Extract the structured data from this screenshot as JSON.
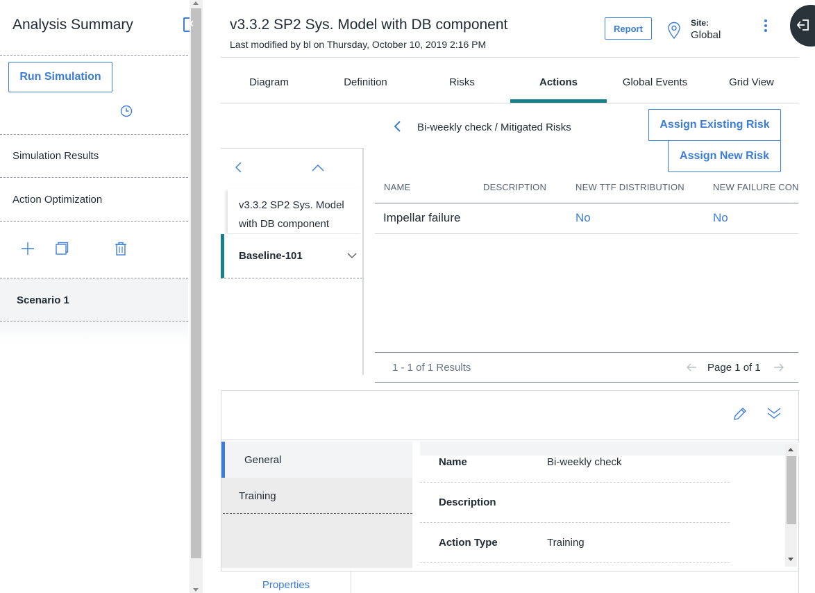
{
  "left_panel": {
    "title": "Analysis Summary",
    "run_simulation": "Run Simulation",
    "items": [
      "Simulation Results",
      "Action Optimization"
    ],
    "scenario": "Scenario 1"
  },
  "header": {
    "title": "v3.3.2 SP2 Sys. Model with DB component",
    "subtitle": "Last modified by bl on Thursday, October 10, 2019 2:16 PM",
    "report_label": "Report",
    "site_label": "Site:",
    "site_value": "Global"
  },
  "tabs": [
    "Diagram",
    "Definition",
    "Risks",
    "Actions",
    "Global Events",
    "Grid View"
  ],
  "active_tab": "Actions",
  "breadcrumb": "Bi-weekly check / Mitigated Risks",
  "assign_existing": "Assign Existing Risk",
  "assign_new": "Assign New Risk",
  "tree": {
    "node1": "v3.3.2 SP2 Sys. Model with DB component",
    "node2": "Baseline-101"
  },
  "grid": {
    "columns": [
      "NAME",
      "DESCRIPTION",
      "NEW TTF DISTRIBUTION",
      "NEW FAILURE CONS"
    ],
    "rows": [
      {
        "name": "Impellar failure",
        "description": "",
        "new_ttf": "No",
        "new_failure": "No"
      }
    ],
    "results": "1 - 1 of 1 Results",
    "page": "Page 1 of 1"
  },
  "details": {
    "side_items": [
      "General",
      "Training"
    ],
    "properties": [
      {
        "label": "Name",
        "value": "Bi-weekly check"
      },
      {
        "label": "Description",
        "value": ""
      },
      {
        "label": "Action Type",
        "value": "Training"
      }
    ],
    "bottom_tab": "Properties"
  },
  "colors": {
    "accent_blue": "#3b7dd8",
    "teal": "#17808a",
    "dark": "#2a323a"
  }
}
